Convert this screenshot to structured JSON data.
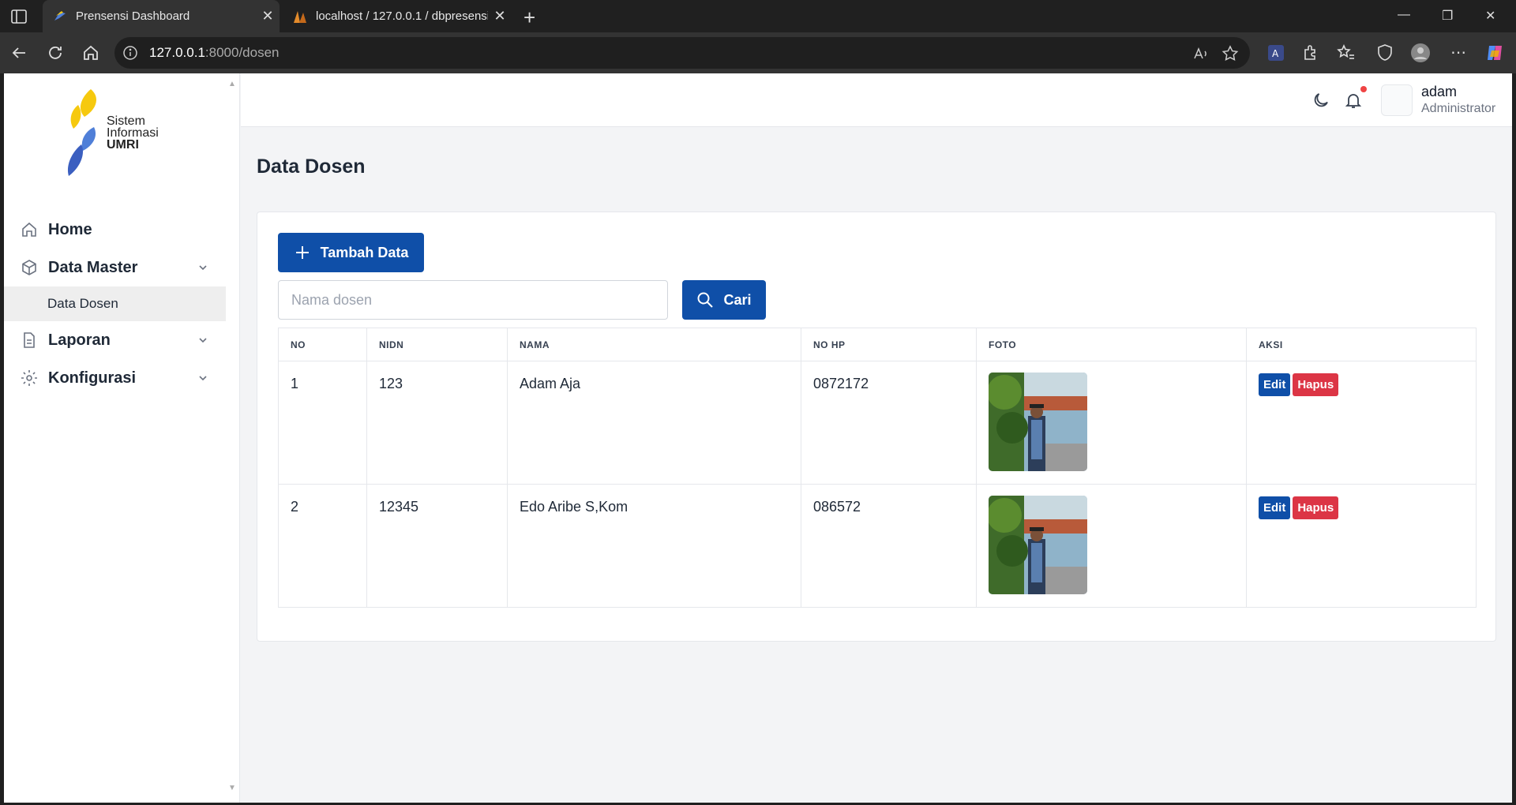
{
  "browser": {
    "tabs": [
      {
        "title": "Prensensi Dashboard",
        "active": true
      },
      {
        "title": "localhost / 127.0.0.1 / dbpresensi",
        "active": false
      }
    ],
    "url_host": "127.0.0.1",
    "url_path": ":8000/dosen"
  },
  "logo": {
    "line1": "Sistem",
    "line2": "Informasi",
    "line3": "UMRI"
  },
  "sidebar": {
    "items": [
      {
        "label": "Home",
        "icon": "home-icon"
      },
      {
        "label": "Data Master",
        "icon": "cube-icon"
      },
      {
        "label": "Laporan",
        "icon": "document-icon"
      },
      {
        "label": "Konfigurasi",
        "icon": "gear-icon"
      }
    ],
    "subitem": "Data Dosen"
  },
  "user": {
    "name": "adam",
    "role": "Administrator"
  },
  "page": {
    "title": "Data Dosen",
    "add_button": "Tambah Data",
    "search_placeholder": "Nama dosen",
    "search_button": "Cari"
  },
  "table": {
    "headers": [
      "NO",
      "NIDN",
      "NAMA",
      "NO HP",
      "FOTO",
      "AKSI"
    ],
    "rows": [
      {
        "no": "1",
        "nidn": "123",
        "nama": "Adam Aja",
        "nohp": "0872172"
      },
      {
        "no": "2",
        "nidn": "12345",
        "nama": "Edo Aribe S,Kom",
        "nohp": "086572"
      }
    ],
    "edit_label": "Edit",
    "delete_label": "Hapus"
  },
  "colors": {
    "primary": "#0f4fa8",
    "danger": "#dc3545",
    "sidebar_active": "#eeeeee"
  }
}
